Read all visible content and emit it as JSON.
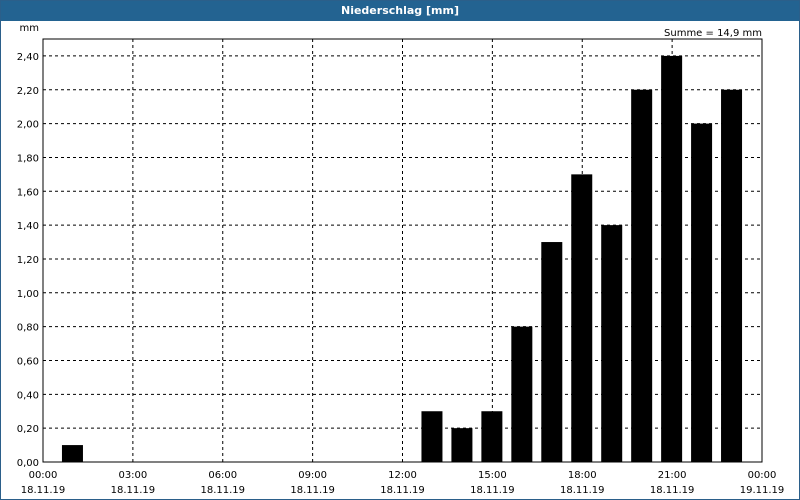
{
  "title": "Niederschlag [mm]",
  "chart_data": {
    "type": "bar",
    "title": "Niederschlag [mm]",
    "ylabel": "mm",
    "summary": "Summe = 14,9 mm",
    "ylim": [
      0,
      2.5
    ],
    "xlim": [
      "18.11.19 00:00",
      "19.11.19 00:00"
    ],
    "yticks": [
      "0,00",
      "0,20",
      "0,40",
      "0,60",
      "0,80",
      "1,00",
      "1,20",
      "1,40",
      "1,60",
      "1,80",
      "2,00",
      "2,20",
      "2,40"
    ],
    "xticks": [
      {
        "time": "00:00",
        "date": "18.11.19"
      },
      {
        "time": "03:00",
        "date": "18.11.19"
      },
      {
        "time": "06:00",
        "date": "18.11.19"
      },
      {
        "time": "09:00",
        "date": "18.11.19"
      },
      {
        "time": "12:00",
        "date": "18.11.19"
      },
      {
        "time": "15:00",
        "date": "18.11.19"
      },
      {
        "time": "18:00",
        "date": "18.11.19"
      },
      {
        "time": "21:00",
        "date": "18.11.19"
      },
      {
        "time": "00:00",
        "date": "19.11.19"
      }
    ],
    "bars": [
      {
        "hour": "01:00",
        "value": 0.1
      },
      {
        "hour": "13:00",
        "value": 0.3
      },
      {
        "hour": "14:00",
        "value": 0.2
      },
      {
        "hour": "15:00",
        "value": 0.3
      },
      {
        "hour": "16:00",
        "value": 0.8
      },
      {
        "hour": "17:00",
        "value": 1.3
      },
      {
        "hour": "18:00",
        "value": 1.7
      },
      {
        "hour": "19:00",
        "value": 1.4
      },
      {
        "hour": "20:00",
        "value": 2.2
      },
      {
        "hour": "21:00",
        "value": 2.4
      },
      {
        "hour": "22:00",
        "value": 2.0
      },
      {
        "hour": "23:00",
        "value": 2.2
      }
    ],
    "grid": true,
    "bar_color": "#000000",
    "grid_color": "#000000"
  }
}
